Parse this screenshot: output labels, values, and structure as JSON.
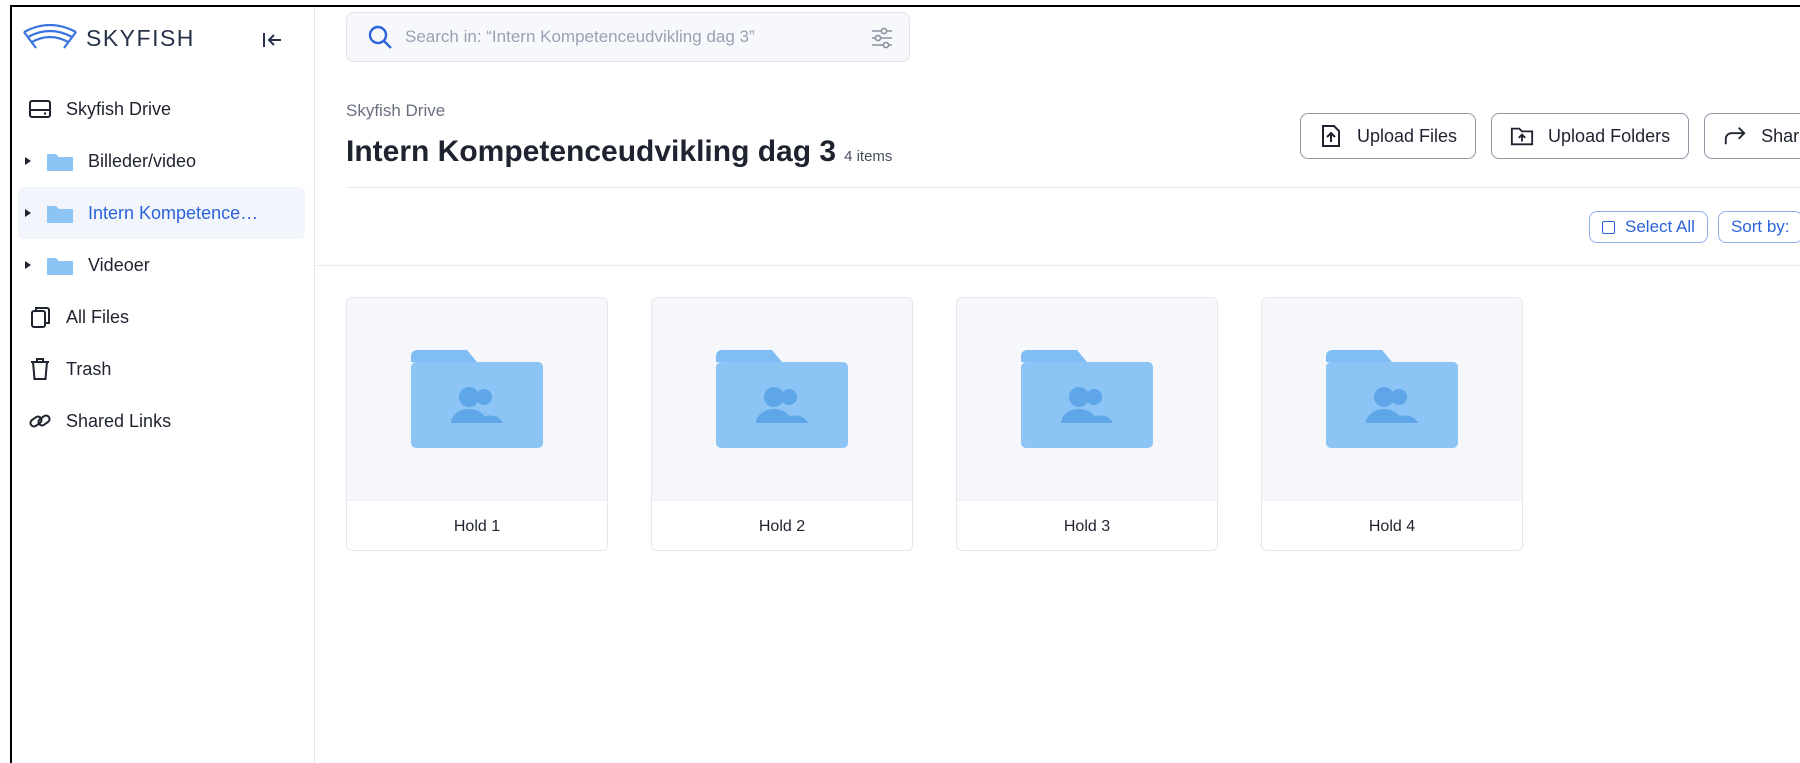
{
  "app": {
    "brand": "SKYFISH",
    "accent_color": "#2b63d9",
    "folder_color": "#8cc4f5"
  },
  "sidebar": {
    "collapse_icon": "collapse-left-icon",
    "items": [
      {
        "label": "Skyfish Drive",
        "icon": "drive-icon"
      },
      {
        "label": "Billeder/video",
        "icon": "folder-icon"
      },
      {
        "label": "Intern Kompetence…",
        "icon": "folder-icon",
        "active": true
      },
      {
        "label": "Videoer",
        "icon": "folder-icon"
      },
      {
        "label": "All Files",
        "icon": "files-icon"
      },
      {
        "label": "Trash",
        "icon": "trash-icon"
      },
      {
        "label": "Shared Links",
        "icon": "link-icon"
      }
    ]
  },
  "search": {
    "placeholder": "Search in: “Intern Kompetenceudvikling dag 3”"
  },
  "header": {
    "breadcrumb": "Skyfish Drive",
    "title": "Intern Kompetenceudvikling dag 3",
    "item_count": "4 items",
    "actions": {
      "upload_files": "Upload Files",
      "upload_folders": "Upload Folders",
      "share": "Shar"
    }
  },
  "toolbar": {
    "select_all": "Select All",
    "sort_by": "Sort by:"
  },
  "folders": [
    {
      "name": "Hold 1",
      "icon": "shared-folder-icon"
    },
    {
      "name": "Hold 2",
      "icon": "shared-folder-icon"
    },
    {
      "name": "Hold 3",
      "icon": "shared-folder-icon"
    },
    {
      "name": "Hold 4",
      "icon": "shared-folder-icon"
    }
  ]
}
